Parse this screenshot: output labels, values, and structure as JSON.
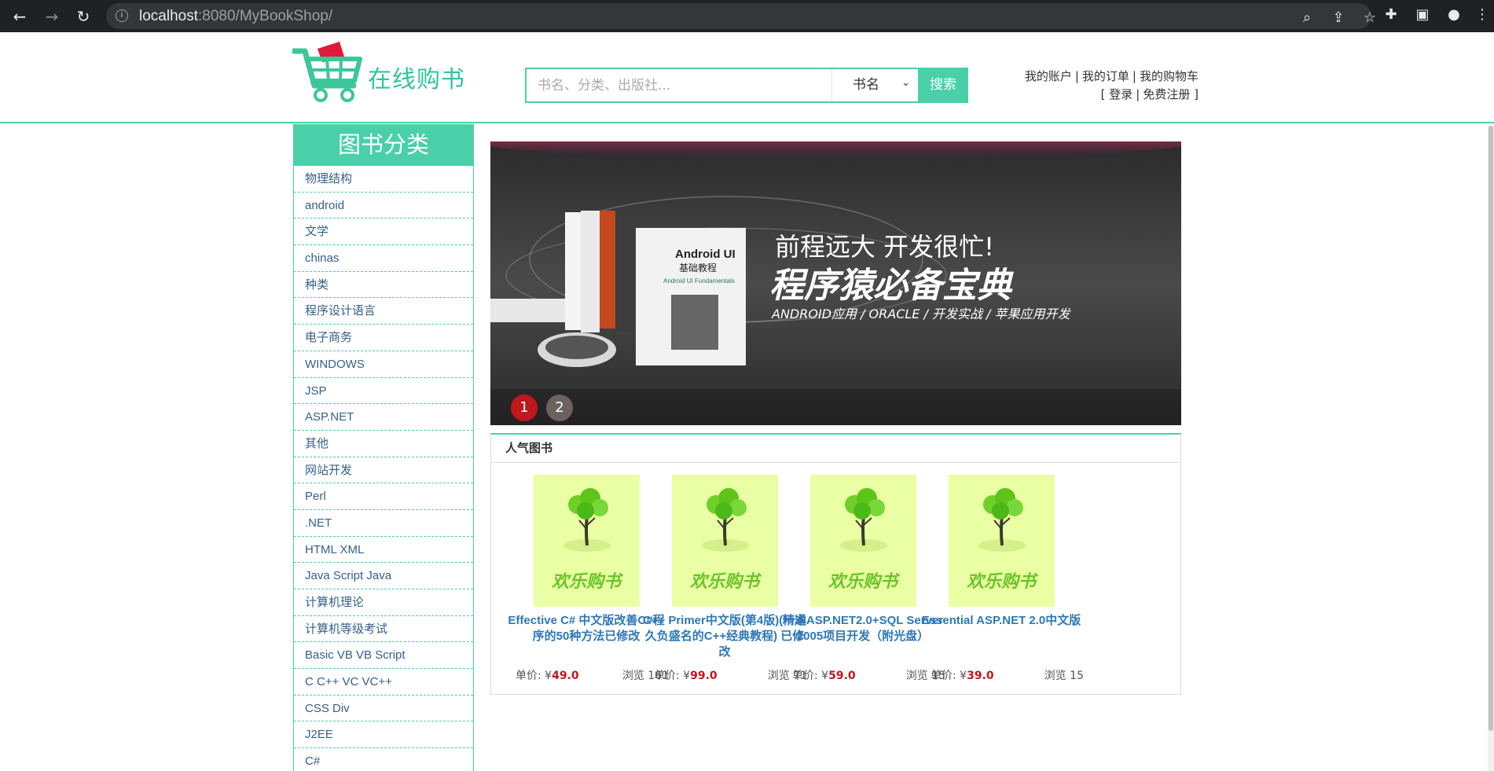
{
  "browser": {
    "url_host": "localhost",
    "url_rest": ":8080/MyBookShop/"
  },
  "header": {
    "logo_text": "在线购书",
    "search_placeholder": "书名、分类、出版社...",
    "search_type": "书名",
    "search_button": "搜索",
    "links_row1": [
      "我的账户",
      "我的订单",
      "我的购物车"
    ],
    "login_open": "[",
    "login": "登录",
    "register": "免费注册",
    "login_close": "]"
  },
  "sidebar": {
    "title": "图书分类",
    "categories": [
      "物理结构",
      "android",
      "文学",
      "chinas",
      "种类",
      "程序设计语言",
      "电子商务",
      "WINDOWS",
      "JSP",
      "ASP.NET",
      "其他",
      "网站开发",
      "Perl",
      ".NET",
      "HTML XML",
      "Java Script Java",
      "计算机理论",
      "计算机等级考试",
      "Basic VB VB Script",
      "C C++ VC VC++",
      "CSS Div",
      "J2EE",
      "C#"
    ]
  },
  "banner": {
    "headline1": "前程远大 开发很忙!",
    "headline2": "程序猿必备宝典",
    "headline3": "ANDROID应用 / ORACLE / 开发实战 / 苹果应用开发",
    "book_title1": "Android UI",
    "book_title2": "基础教程",
    "book_subtitle": "Android UI Fundamentals",
    "dots": [
      "1",
      "2"
    ]
  },
  "popular": {
    "title": "人气图书",
    "price_label": "单价: ",
    "views_label": "浏览 ",
    "currency": "¥",
    "cover_text": "欢乐购书",
    "books": [
      {
        "title": "Effective C# 中文版改善C#程序的50种方法已修改",
        "price": "49.0",
        "views": "161"
      },
      {
        "title": "C++ Primer中文版(第4版)(一本久负盛名的C++经典教程)  已修改",
        "price": "99.0",
        "views": "71"
      },
      {
        "title": "精通ASP.NET2.0+SQL Server 2005项目开发（附光盘）",
        "price": "59.0",
        "views": "15"
      },
      {
        "title": "Essential ASP.NET 2.0中文版",
        "price": "39.0",
        "views": "15"
      }
    ]
  }
}
